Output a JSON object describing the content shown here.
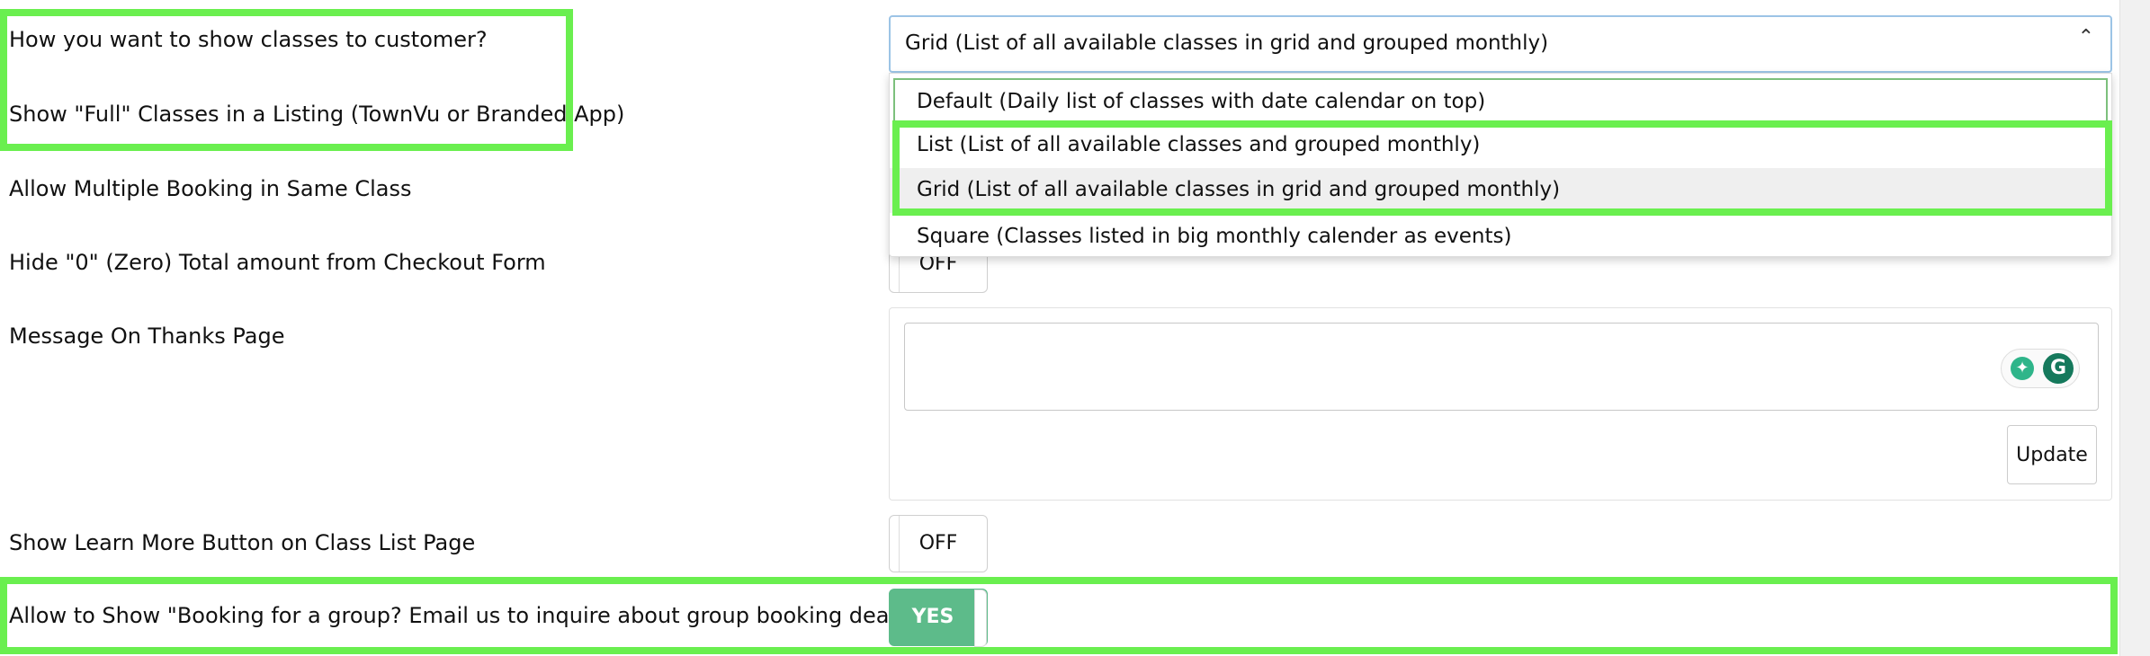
{
  "settings": {
    "show_classes_label": "How you want to show classes to customer?",
    "show_full_label": "Show \"Full\" Classes in a Listing (TownVu or Branded App)",
    "multiple_booking_label": "Allow Multiple Booking in Same Class",
    "hide_zero_label": "Hide \"0\" (Zero) Total amount from Checkout Form",
    "thanks_message_label": "Message On Thanks Page",
    "learn_more_label": "Show Learn More Button on Class List Page",
    "group_link_label": "Allow to Show \"Booking for a group? Email us to inquire about group booking deals\" Link"
  },
  "display_select": {
    "selected": "Grid (List of all available classes in grid and grouped monthly)",
    "options": [
      "Default (Daily list of classes with date calendar on top)",
      "List (List of all available classes and grouped monthly)",
      "Grid (List of all available classes in grid and grouped monthly)",
      "Square (Classes listed in big monthly calender as events)"
    ]
  },
  "toggles": {
    "hide_zero": "OFF",
    "learn_more": "OFF",
    "group_link": "YES"
  },
  "thanks_page": {
    "message_value": "",
    "update_label": "Update"
  },
  "colors": {
    "highlight": "#6aef4f",
    "toggle_on": "#5dbb8a",
    "grammarly": "#15795c"
  }
}
